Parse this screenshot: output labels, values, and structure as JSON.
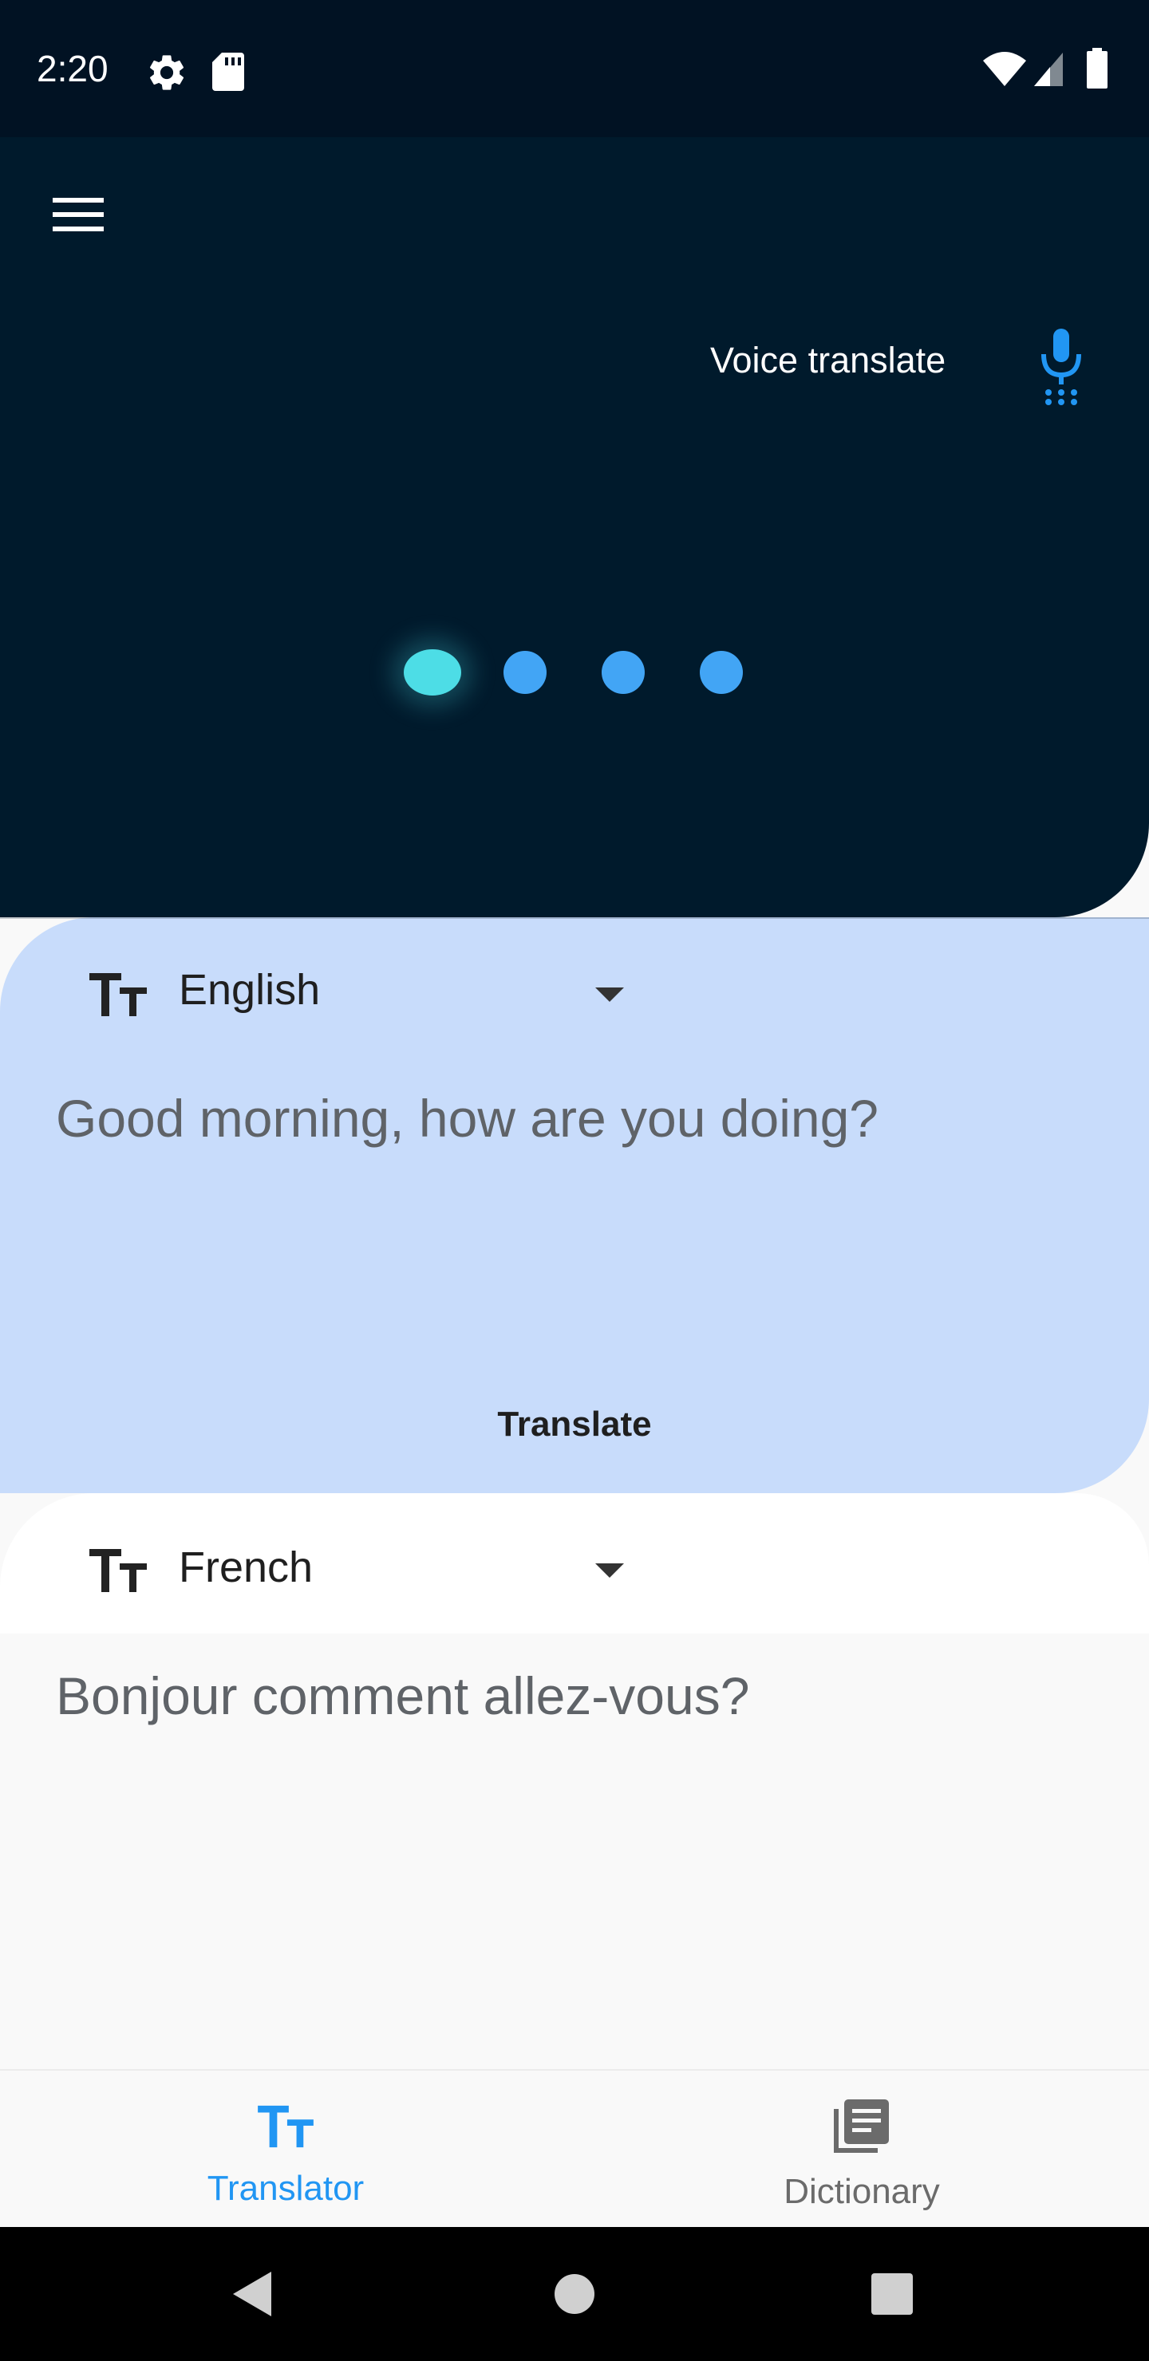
{
  "status_bar": {
    "time": "2:20",
    "icons": [
      "gear-icon",
      "sd-card-icon",
      "wifi-icon",
      "signal-icon",
      "battery-icon"
    ]
  },
  "header": {
    "menu_icon": "hamburger-menu-icon",
    "voice_translate_label": "Voice translate",
    "mic_icon": "microphone-icon",
    "page_indicator": {
      "count": 4,
      "active_index": 0
    }
  },
  "source": {
    "language": "English",
    "text": "Good morning, how are you doing?",
    "icon": "text-size-icon"
  },
  "translate_button_label": "Translate",
  "target": {
    "language": "French",
    "text": "Bonjour comment allez-vous?",
    "icon": "text-size-icon"
  },
  "bottom_nav": {
    "items": [
      {
        "label": "Translator",
        "icon": "text-size-icon",
        "active": true
      },
      {
        "label": "Dictionary",
        "icon": "dictionary-icon",
        "active": false
      }
    ]
  },
  "colors": {
    "status_bar_bg": "#011223",
    "header_bg": "#001a2c",
    "source_panel_bg": "#c8dcfb",
    "accent": "#2196f3",
    "dot": "#42a5f5",
    "active_dot": "#4ddde6"
  }
}
